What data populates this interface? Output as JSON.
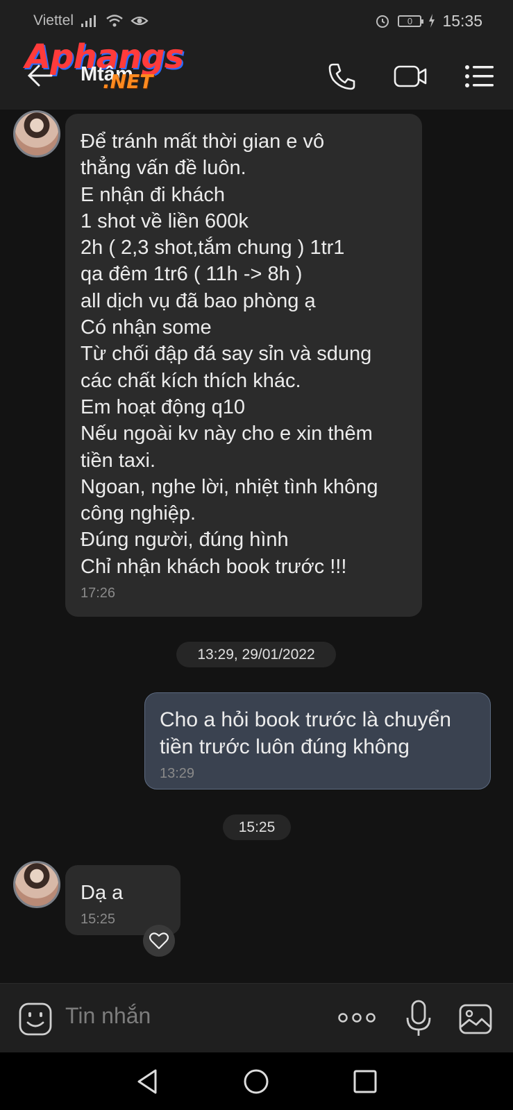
{
  "status_bar": {
    "carrier": "Viettel",
    "battery": "0",
    "time": "15:35"
  },
  "header": {
    "contact_name": "Mtâm",
    "watermark_main": "Aphangs",
    "watermark_sub": ".NET",
    "icons": [
      "back-arrow-icon",
      "phone-icon",
      "video-call-icon",
      "menu-list-icon"
    ]
  },
  "messages": [
    {
      "direction": "incoming",
      "lines": [
        "Để tránh mất thời gian e vô",
        "thẳng vấn đề luôn.",
        "E nhận đi khách",
        "1 shot về liền 600k",
        "2h ( 2,3 shot,tắm chung ) 1tr1",
        "qa đêm 1tr6 ( 11h -> 8h )",
        "all dịch vụ đã bao phòng ạ",
        "Có nhận some",
        "Từ chối đập đá say sỉn và sdung",
        "các chất kích thích khác.",
        "Em hoạt động q10",
        "Nếu ngoài kv này cho e xin thêm",
        "tiền taxi.",
        "Ngoan, nghe lời, nhiệt tình không",
        "công nghiệp.",
        "Đúng người, đúng hình",
        "Chỉ nhận khách book trước !!!"
      ],
      "time": "17:26"
    },
    {
      "separator": "13:29, 29/01/2022"
    },
    {
      "direction": "outgoing",
      "lines": [
        "Cho a hỏi book trước là chuyển",
        "tiền trước luôn đúng không"
      ],
      "time": "13:29"
    },
    {
      "separator": "15:25"
    },
    {
      "direction": "incoming",
      "lines": [
        "Dạ a"
      ],
      "time": "15:25"
    }
  ],
  "composer": {
    "placeholder": "Tin nhắn",
    "icons": [
      "emoji-icon",
      "more-dots-icon",
      "microphone-icon",
      "gallery-icon"
    ]
  },
  "colors": {
    "background": "#131313",
    "incoming_bubble": "#2b2b2b",
    "outgoing_bubble": "#3a4250",
    "bar": "#1f1f1f"
  }
}
